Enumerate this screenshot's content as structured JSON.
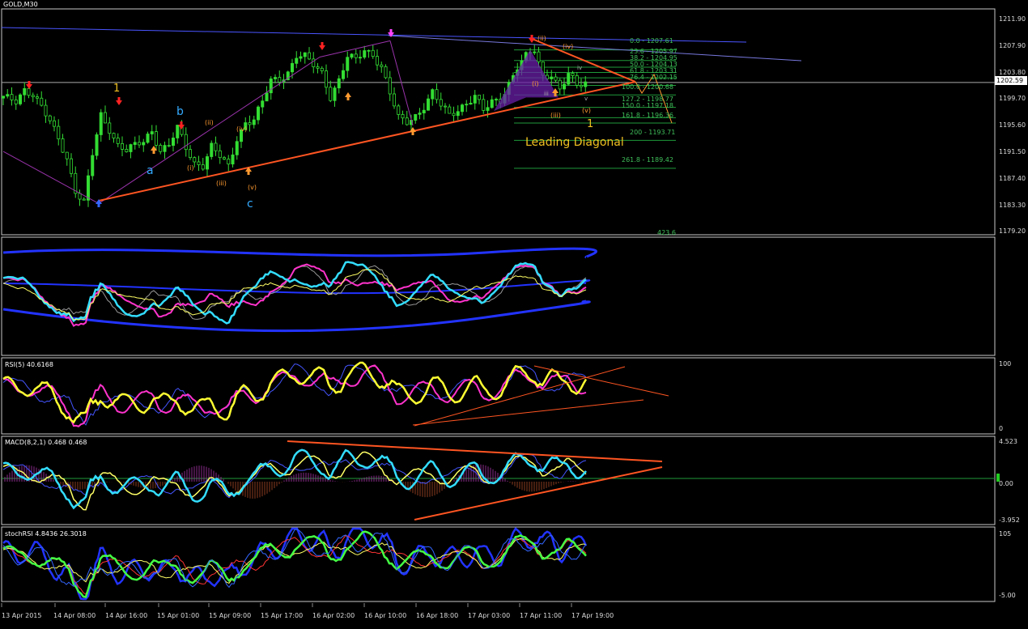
{
  "symbol": "GOLD,M30",
  "colors": {
    "background": "#000000",
    "candle": "#33dd33",
    "trendline": "#ff5522",
    "channel": "#4a55ff",
    "fib": "#1f9a3a",
    "wave_orange": "#ff9a30",
    "wave_blue": "#33aaff",
    "wave_yellow": "#f0c020",
    "rsi_main": "#ffff33",
    "rsi_signal": "#ff33cc",
    "macd_main": "#33ddff",
    "stoch_blue": "#2233ff",
    "stoch_green": "#44ff44"
  },
  "price_axis": {
    "ticks": [
      "1211.90",
      "1207.90",
      "1203.80",
      "1199.70",
      "1195.60",
      "1191.50",
      "1187.40",
      "1183.30",
      "1179.20"
    ],
    "current": "1202.59"
  },
  "time_axis": {
    "ticks": [
      "13 Apr 2015",
      "14 Apr 08:00",
      "14 Apr 16:00",
      "15 Apr 01:00",
      "15 Apr 09:00",
      "15 Apr 17:00",
      "16 Apr 02:00",
      "16 Apr 10:00",
      "16 Apr 18:00",
      "17 Apr 03:00",
      "17 Apr 11:00",
      "17 Apr 19:00"
    ]
  },
  "fib_levels": [
    "0.0 - 1207.61",
    "23.6 - 1205.97",
    "38.2 - 1204.95",
    "50.0 - 1204.13",
    "61.8 - 1203.31",
    "76.4 - 1202.15",
    "100.0 - 1200.68",
    "127.2 - 1198.77",
    "150.0 - 1197.18",
    "161.8 - 1196.36",
    "200 - 1193.71",
    "261.8 - 1189.42",
    "423.6"
  ],
  "annotations": {
    "leading_diagonal": "Leading Diagonal",
    "waves_main": [
      "1",
      "a",
      "b",
      "c",
      "(i)",
      "(ii)",
      "(iii)",
      "(iv)",
      "(v)"
    ],
    "waves_recent": [
      "(ii)",
      "(iv)",
      "(i)",
      "(iii)",
      "(v)",
      "1",
      "iii",
      "iv",
      "v"
    ]
  },
  "indicators": {
    "bands_panel": {
      "title": ""
    },
    "rsi": {
      "title": "RSI(5) 40.6168",
      "scale_max": "100",
      "scale_min": "0"
    },
    "macd": {
      "title": "MACD(8,2,1) 0.468 0.468",
      "scale_max": "4.523",
      "scale_zero": "0.00",
      "scale_min": "-3.952"
    },
    "stoch": {
      "title": "stochRSI 4.8436 26.3018",
      "scale_max": "105",
      "scale_min": "-5.00"
    }
  },
  "chart_data": {
    "type": "candlestick",
    "symbol": "GOLD",
    "timeframe": "M30",
    "ylim": [
      1179.2,
      1213.9
    ],
    "x_categories": [
      "13 Apr 2015",
      "14 Apr 08:00",
      "14 Apr 16:00",
      "15 Apr 01:00",
      "15 Apr 09:00",
      "15 Apr 17:00",
      "16 Apr 02:00",
      "16 Apr 10:00",
      "16 Apr 18:00",
      "17 Apr 03:00",
      "17 Apr 11:00",
      "17 Apr 19:00"
    ],
    "approx_close_path": [
      [
        0,
        1200.2
      ],
      [
        3,
        1199.8
      ],
      [
        5,
        1201.6
      ],
      [
        7,
        1200.8
      ],
      [
        9,
        1198.7
      ],
      [
        11,
        1196.5
      ],
      [
        13,
        1194.0
      ],
      [
        15,
        1191.0
      ],
      [
        17,
        1186.0
      ],
      [
        19,
        1184.0
      ],
      [
        21,
        1191.5
      ],
      [
        23,
        1197.5
      ],
      [
        25,
        1195.5
      ],
      [
        27,
        1193.0
      ],
      [
        29,
        1192.2
      ],
      [
        31,
        1192.8
      ],
      [
        33,
        1193.5
      ],
      [
        35,
        1195.2
      ],
      [
        37,
        1192.2
      ],
      [
        39,
        1193.0
      ],
      [
        41,
        1195.5
      ],
      [
        43,
        1192.5
      ],
      [
        45,
        1190.2
      ],
      [
        47,
        1190.0
      ],
      [
        49,
        1192.8
      ],
      [
        51,
        1191.2
      ],
      [
        53,
        1189.5
      ],
      [
        55,
        1194.0
      ],
      [
        57,
        1196.5
      ],
      [
        59,
        1197.0
      ],
      [
        61,
        1199.5
      ],
      [
        63,
        1202.8
      ],
      [
        65,
        1203.0
      ],
      [
        67,
        1204.2
      ],
      [
        69,
        1206.8
      ],
      [
        71,
        1206.5
      ],
      [
        73,
        1205.2
      ],
      [
        75,
        1204.0
      ],
      [
        77,
        1200.5
      ],
      [
        79,
        1203.0
      ],
      [
        81,
        1206.5
      ],
      [
        83,
        1206.0
      ],
      [
        85,
        1207.5
      ],
      [
        87,
        1207.0
      ],
      [
        89,
        1205.0
      ],
      [
        91,
        1201.0
      ],
      [
        93,
        1197.0
      ],
      [
        95,
        1196.5
      ],
      [
        97,
        1197.5
      ],
      [
        99,
        1199.0
      ],
      [
        101,
        1201.0
      ],
      [
        103,
        1199.0
      ],
      [
        105,
        1197.5
      ],
      [
        107,
        1198.5
      ],
      [
        109,
        1199.5
      ],
      [
        111,
        1200.5
      ],
      [
        113,
        1198.2
      ],
      [
        115,
        1199.5
      ],
      [
        117,
        1200.0
      ],
      [
        119,
        1202.5
      ],
      [
        121,
        1205.0
      ],
      [
        123,
        1206.5
      ],
      [
        125,
        1207.5
      ],
      [
        127,
        1203.5
      ],
      [
        129,
        1204.0
      ],
      [
        131,
        1201.5
      ],
      [
        133,
        1203.8
      ],
      [
        135,
        1202.0
      ],
      [
        137,
        1202.6
      ]
    ],
    "trendlines": [
      {
        "name": "lower trendline",
        "from": [
          19,
          1184.0
        ],
        "to": [
          135,
          1202.5
        ]
      },
      {
        "name": "upper channel",
        "from": [
          0,
          1210.2
        ],
        "to": [
          170,
          1206.5
        ]
      }
    ],
    "current_price": 1202.59
  }
}
